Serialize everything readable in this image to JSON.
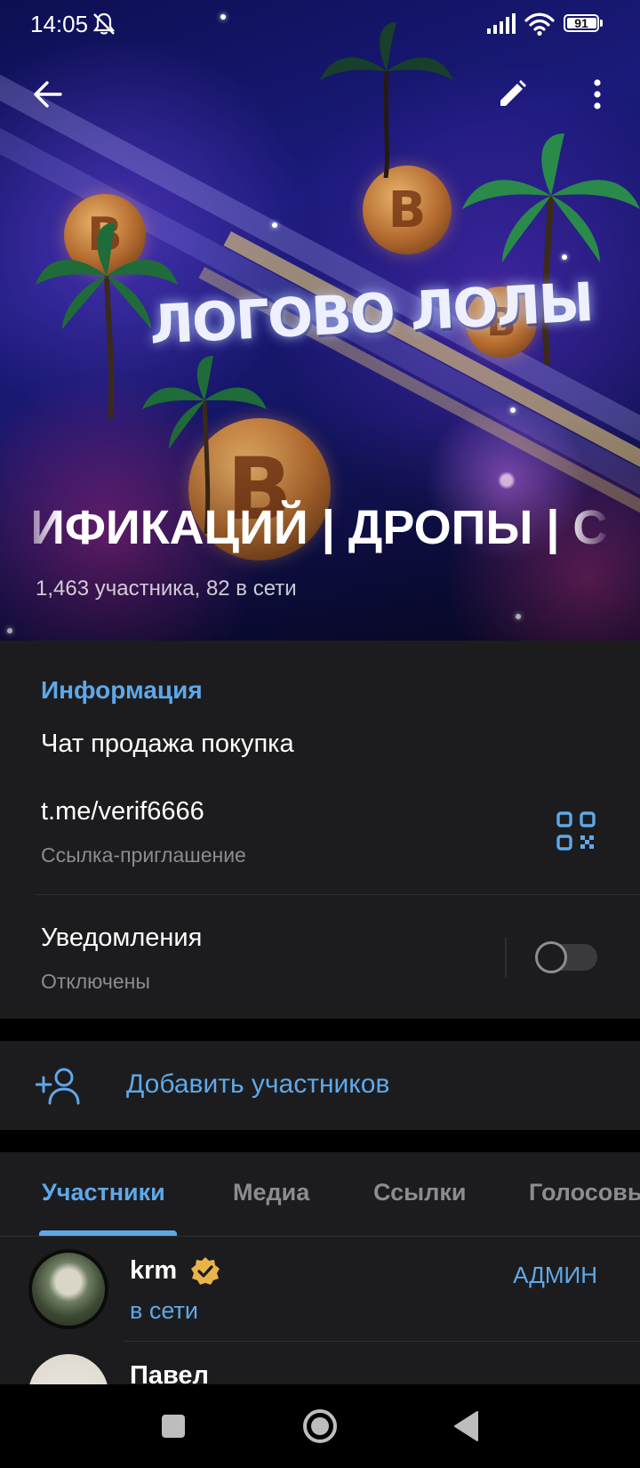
{
  "status_bar": {
    "time": "14:05",
    "battery": "91"
  },
  "header": {
    "banner_logo_text": "ЛОГОВО ЛОЛЫ",
    "title_visible": "ИФИКАЦИЙ | ДРОПЫ | С",
    "subtitle": "1,463 участника, 82 в сети"
  },
  "info": {
    "section_label": "Информация",
    "description": "Чат продажа покупка",
    "link": "t.me/verif6666",
    "link_caption": "Ссылка-приглашение",
    "notifications_label": "Уведомления",
    "notifications_state": "Отключены"
  },
  "actions": {
    "add_members": "Добавить участников"
  },
  "tabs": [
    {
      "label": "Участники"
    },
    {
      "label": "Медиа"
    },
    {
      "label": "Ссылки"
    },
    {
      "label": "Голосовые"
    }
  ],
  "members": [
    {
      "name": "krm",
      "status": "в сети",
      "role": "АДМИН",
      "verified": true
    },
    {
      "name": "Павел"
    }
  ],
  "colors": {
    "accent": "#5fa8e8",
    "card_bg": "#1c1c1e",
    "verified_badge": "#e8b44a"
  }
}
